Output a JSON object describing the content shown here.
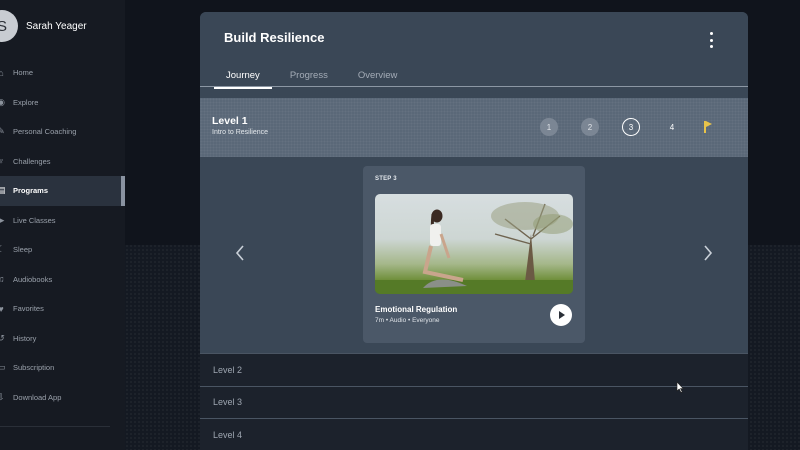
{
  "user": {
    "initial": "S",
    "name": "Sarah Yeager"
  },
  "sidebar": {
    "items": [
      {
        "label": "Home",
        "icon": "home-icon",
        "glyph": "⌂"
      },
      {
        "label": "Explore",
        "icon": "compass-icon",
        "glyph": "◉"
      },
      {
        "label": "Personal Coaching",
        "icon": "coaching-icon",
        "glyph": "✎"
      },
      {
        "label": "Challenges",
        "icon": "trophy-icon",
        "glyph": "♆"
      },
      {
        "label": "Programs",
        "icon": "programs-icon",
        "glyph": "▤",
        "active": true
      },
      {
        "label": "Live Classes",
        "icon": "live-icon",
        "glyph": "▶"
      },
      {
        "label": "Sleep",
        "icon": "moon-icon",
        "glyph": "☾"
      },
      {
        "label": "Audiobooks",
        "icon": "headphones-icon",
        "glyph": "♫"
      },
      {
        "label": "Favorites",
        "icon": "heart-icon",
        "glyph": "♥"
      },
      {
        "label": "History",
        "icon": "history-icon",
        "glyph": "↺"
      },
      {
        "label": "Subscription",
        "icon": "card-icon",
        "glyph": "▭"
      },
      {
        "label": "Download App",
        "icon": "download-icon",
        "glyph": "⇩"
      }
    ]
  },
  "program": {
    "title": "Build Resilience",
    "tabs": [
      {
        "label": "Journey",
        "active": true
      },
      {
        "label": "Progress",
        "active": false
      },
      {
        "label": "Overview",
        "active": false
      }
    ]
  },
  "level1": {
    "title": "Level 1",
    "subtitle": "Intro to Resilience",
    "steps": [
      {
        "label": "1",
        "state": "done"
      },
      {
        "label": "2",
        "state": "done"
      },
      {
        "label": "3",
        "state": "current"
      },
      {
        "label": "4",
        "state": "future"
      }
    ]
  },
  "current_step": {
    "label": "STEP 3",
    "title": "Emotional Regulation",
    "meta": "7m • Audio • Everyone"
  },
  "levels": [
    "Level 2",
    "Level 3",
    "Level 4"
  ],
  "colors": {
    "flag": "#e8c34a",
    "card": "#3a4756",
    "band": "#5a6878"
  }
}
